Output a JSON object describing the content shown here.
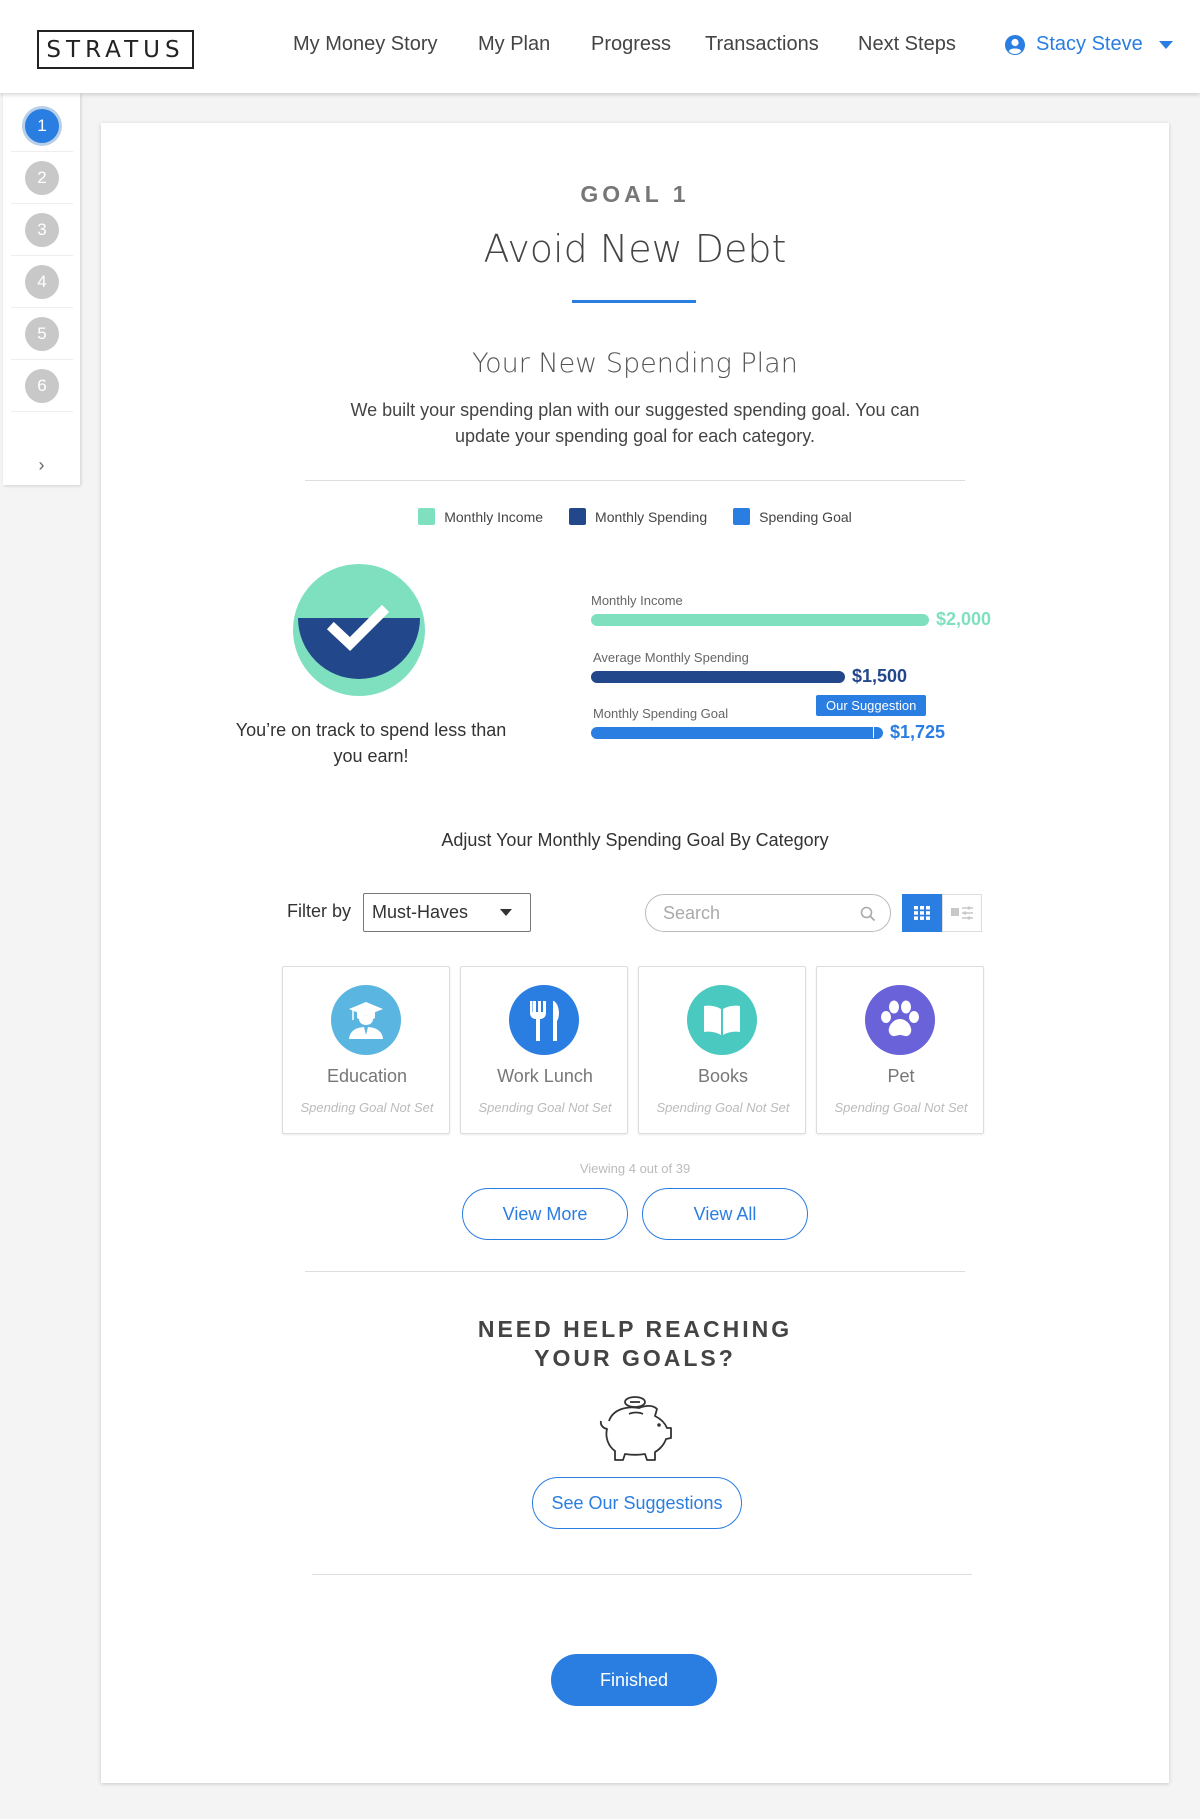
{
  "header": {
    "logo": "STRATUS",
    "nav": [
      {
        "label": "My Money Story"
      },
      {
        "label": "My Plan"
      },
      {
        "label": "Progress"
      },
      {
        "label": "Transactions"
      },
      {
        "label": "Next Steps"
      }
    ],
    "user_name": "Stacy Steve",
    "user_icon": "user-circle-icon",
    "menu_icon": "chevron-down-icon"
  },
  "steps": {
    "items": [
      "1",
      "2",
      "3",
      "4",
      "5",
      "6"
    ],
    "active": "1",
    "next_icon": "chevron-right-icon",
    "next_glyph": "›"
  },
  "goal": {
    "label": "GOAL 1",
    "title": "Avoid New Debt"
  },
  "plan": {
    "title": "Your New Spending Plan",
    "description": "We built your spending plan with our suggested spending goal. You can update your spending goal for each category."
  },
  "legend": [
    {
      "label": "Monthly Income",
      "color": "#7fe0c0"
    },
    {
      "label": "Monthly Spending",
      "color": "#22478a"
    },
    {
      "label": "Spending Goal",
      "color": "#2a7de1"
    }
  ],
  "status": {
    "text": "You’re on track to spend less than you earn!",
    "icon": "checkmark-icon"
  },
  "bars": {
    "income": {
      "label": "Monthly Income",
      "value": "$2,000",
      "amount": 2000,
      "color": "#7fe0c0"
    },
    "spending": {
      "label": "Average Monthly Spending",
      "value": "$1,500",
      "amount": 1500,
      "color": "#22478a"
    },
    "goal": {
      "label": "Monthly Spending Goal",
      "value": "$1,725",
      "amount": 1725,
      "color": "#2a7de1",
      "suggestion_label": "Our Suggestion"
    }
  },
  "adjust": {
    "title": "Adjust Your Monthly Spending Goal By Category",
    "filter_label": "Filter by",
    "filter_value": "Must-Haves",
    "search_placeholder": "Search"
  },
  "categories": [
    {
      "name": "Education",
      "status": "Spending Goal Not Set",
      "icon": "graduate-icon",
      "color": "#5ab6e0"
    },
    {
      "name": "Work Lunch",
      "status": "Spending Goal Not Set",
      "icon": "fork-knife-icon",
      "color": "#2a7de1"
    },
    {
      "name": "Books",
      "status": "Spending Goal Not Set",
      "icon": "book-icon",
      "color": "#4ac9c1"
    },
    {
      "name": "Pet",
      "status": "Spending Goal Not Set",
      "icon": "paw-icon",
      "color": "#6a62d9"
    }
  ],
  "viewing": "Viewing 4 out of 39",
  "buttons": {
    "view_more": "View More",
    "view_all": "View All",
    "suggestions": "See Our Suggestions",
    "finished": "Finished"
  },
  "help": {
    "title_line1": "NEED HELP REACHING",
    "title_line2": "YOUR GOALS?",
    "icon": "piggy-bank-icon"
  }
}
